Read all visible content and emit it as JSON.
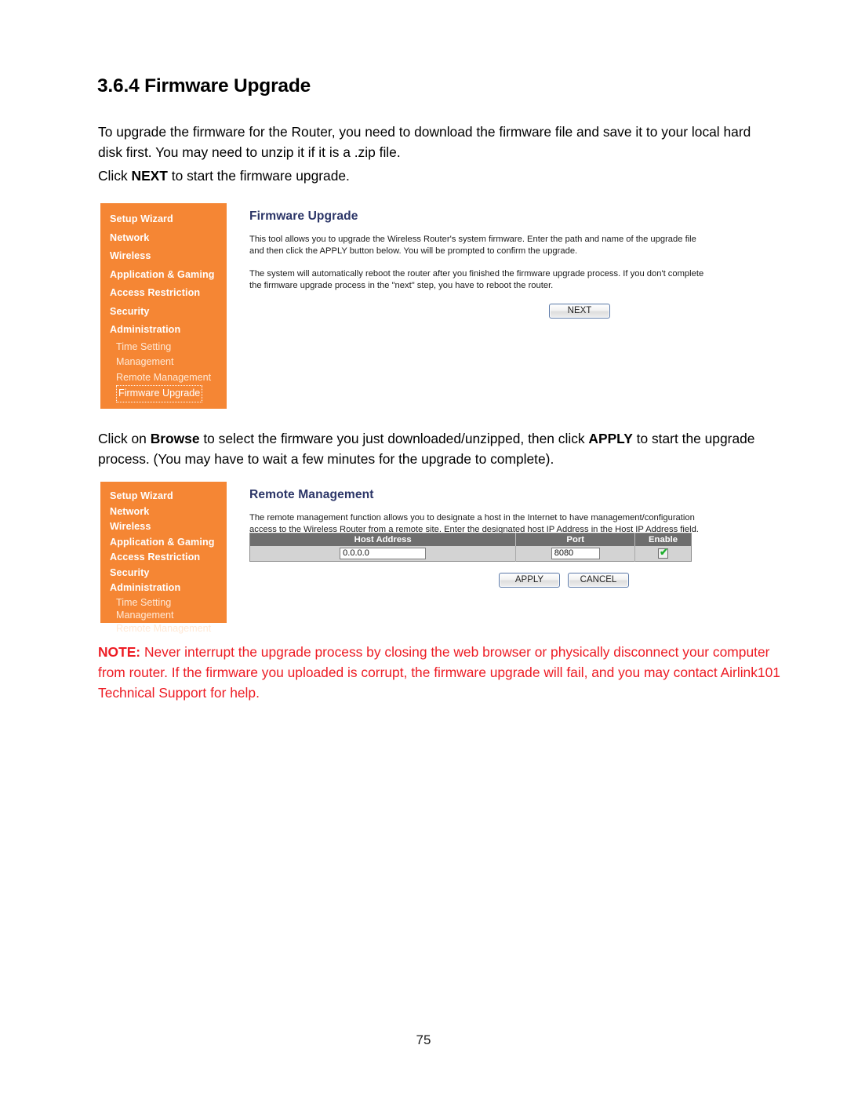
{
  "document": {
    "heading": "3.6.4 Firmware Upgrade",
    "paragraph_intro": "To upgrade the firmware for the Router, you need to download the firmware file and save it to your local hard disk first. You may need to unzip it if it is a .zip file.",
    "paragraph_click_next_pre": "Click ",
    "paragraph_click_next_bold": "NEXT",
    "paragraph_click_next_post": " to start the firmware upgrade.",
    "paragraph_browse_pre": "Click on ",
    "paragraph_browse_bold1": "Browse",
    "paragraph_browse_mid": " to select the firmware you just downloaded/unzipped, then click ",
    "paragraph_browse_bold2": "APPLY",
    "paragraph_browse_post": " to start the upgrade process. (You may have to wait a few minutes for the upgrade to complete).",
    "note_label": "NOTE:",
    "note_text": " Never interrupt the upgrade process by closing the web browser or physically disconnect your computer from router. If the firmware you uploaded is corrupt, the firmware upgrade will fail, and you may contact Airlink101 Technical Support for help.",
    "page_number": "75"
  },
  "colors": {
    "sidebar_orange": "#f58634",
    "panel_title_blue": "#2c3668",
    "note_red": "#ed1c24",
    "table_header_gray": "#6e6e6e",
    "table_row_gray": "#d3d3d3",
    "checkbox_green": "#1fae2e"
  },
  "screenshot_firmware_upgrade": {
    "sidebar": {
      "top_items": [
        "Setup Wizard",
        "Network",
        "Wireless",
        "Application & Gaming",
        "Access Restriction",
        "Security",
        "Administration"
      ],
      "sub_items": [
        "Time Setting",
        "Management",
        "Remote Management",
        "Firmware Upgrade"
      ],
      "selected_sub_item": "Firmware Upgrade"
    },
    "panel_title": "Firmware Upgrade",
    "body_paragraph_1": "This tool allows you to upgrade the Wireless Router's system firmware. Enter the path and name of the upgrade file and then click the APPLY button below. You will be prompted to confirm the upgrade.",
    "body_paragraph_2": "The system will automatically reboot the router after you finished the firmware upgrade process. If you don't complete the firmware upgrade process in the \"next\" step, you have to reboot the router.",
    "next_button_label": "NEXT"
  },
  "screenshot_remote_management": {
    "sidebar": {
      "top_items": [
        "Setup Wizard",
        "Network",
        "Wireless",
        "Application & Gaming",
        "Access Restriction",
        "Security",
        "Administration"
      ],
      "sub_items": [
        "Time Setting",
        "Management",
        "Remote Management"
      ]
    },
    "panel_title": "Remote Management",
    "body_paragraph_1": "The remote management function allows you to designate a host in the Internet to have management/configuration access to the Wireless Router from a remote site. Enter the designated host IP Address in the Host IP Address field.",
    "table": {
      "headers": [
        "Host Address",
        "Port",
        "Enable"
      ],
      "row": {
        "host_address": "0.0.0.0",
        "port": "8080",
        "enable_checked": true,
        "enable_glyph": "✔"
      }
    },
    "apply_button_label": "APPLY",
    "cancel_button_label": "CANCEL"
  }
}
